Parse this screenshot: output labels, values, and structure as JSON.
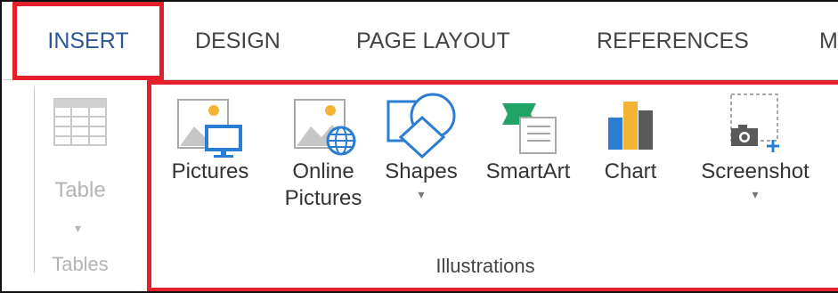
{
  "tabs": [
    {
      "label": "INSERT",
      "active": true
    },
    {
      "label": "DESIGN"
    },
    {
      "label": "PAGE LAYOUT"
    },
    {
      "label": "REFERENCES"
    },
    {
      "label": "M"
    }
  ],
  "groups": {
    "tables": {
      "label": "Tables",
      "commands": [
        {
          "label": "Table",
          "arrow": "▾",
          "icon": "table-icon",
          "enabled": false
        }
      ]
    },
    "illustrations": {
      "label": "Illustrations",
      "commands": [
        {
          "label": "Pictures",
          "icon": "pictures-icon"
        },
        {
          "label": "Online",
          "label2": "Pictures",
          "icon": "online-pictures-icon"
        },
        {
          "label": "Shapes",
          "arrow": "▾",
          "icon": "shapes-icon"
        },
        {
          "label": "SmartArt",
          "icon": "smartart-icon"
        },
        {
          "label": "Chart",
          "icon": "chart-icon"
        },
        {
          "label": "Screenshot",
          "arrow": "▾",
          "icon": "screenshot-icon"
        }
      ]
    }
  },
  "colors": {
    "accent_tab": "#2b579a",
    "highlight": "#e3202c",
    "disabled": "#b4b4b4",
    "icon_blue": "#2b7cd3",
    "icon_orange": "#f5b335",
    "icon_green": "#21a366"
  }
}
